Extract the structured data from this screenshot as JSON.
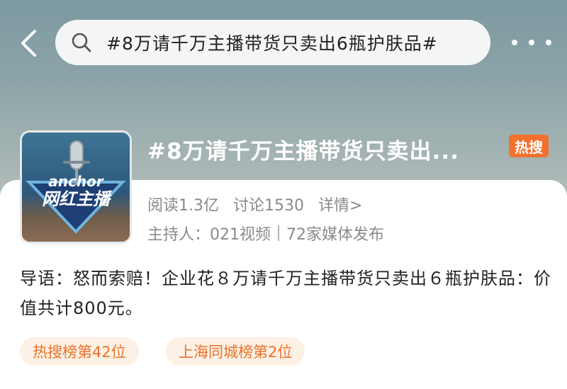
{
  "search": {
    "query": "#8万请千万主播带货只卖出6瓶护肤品#"
  },
  "topic": {
    "title": "#8万请千万主播带货只卖出...",
    "badge": "热搜",
    "cover_text": "网红主播",
    "cover_subtext": "anchor",
    "reads": "阅读1.3亿",
    "discussions": "讨论1530",
    "details_link": "详情>",
    "host": "主持人：021视频",
    "media": "72家媒体发布",
    "intro": "导语：怒而索赔！企业花８万请千万主播带货只卖出６瓶护肤品：价值共计800元。"
  },
  "tags": [
    {
      "label": "热搜榜第42位"
    },
    {
      "label": "上海同城榜第2位"
    }
  ],
  "colors": {
    "accent": "#f3702f",
    "tag_bg": "#fdf0e4",
    "tag_text": "#e8732c"
  }
}
